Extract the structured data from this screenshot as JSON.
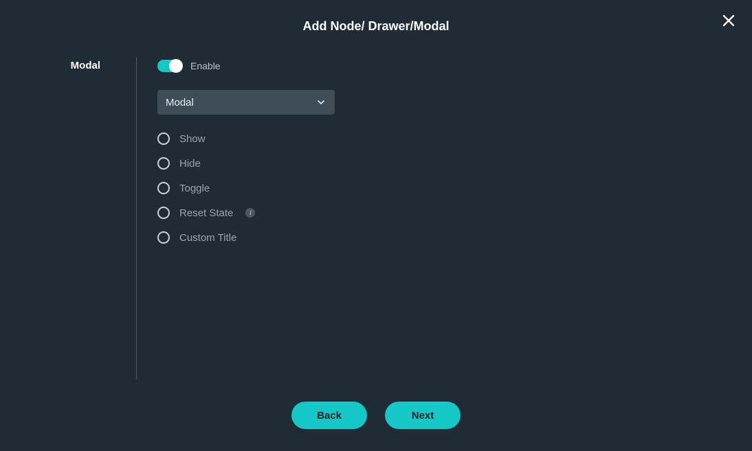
{
  "title": "Add Node/ Drawer/Modal",
  "side_label": "Modal",
  "enable": {
    "label": "Enable",
    "on": true
  },
  "select": {
    "value": "Modal"
  },
  "radios": [
    {
      "label": "Show",
      "info": false
    },
    {
      "label": "Hide",
      "info": false
    },
    {
      "label": "Toggle",
      "info": false
    },
    {
      "label": "Reset State",
      "info": true
    },
    {
      "label": "Custom Title",
      "info": false
    }
  ],
  "footer": {
    "back": "Back",
    "next": "Next"
  }
}
